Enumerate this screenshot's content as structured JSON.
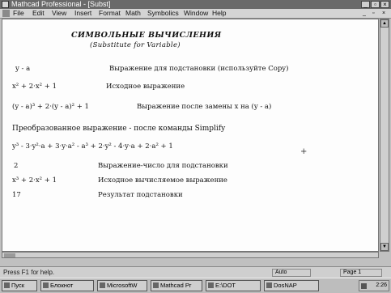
{
  "window": {
    "title": "Mathcad Professional - [Subst]",
    "controls": [
      "_",
      "▫",
      "×"
    ]
  },
  "menu": {
    "items": [
      "File",
      "Edit",
      "View",
      "Insert",
      "Format",
      "Math",
      "Symbolics",
      "Window",
      "Help"
    ],
    "doc_controls": [
      "_",
      "▫",
      "×"
    ]
  },
  "document": {
    "heading": "СИМВОЛЬНЫЕ ВЫЧИСЛЕНИЯ",
    "subheading": "(Substitute for Variable)",
    "rows": [
      {
        "math": "y - a",
        "text": "Выражение для подстановки  (используйте Copy)"
      },
      {
        "math": "x² + 2·x² + 1",
        "text": "Исходное выражение"
      },
      {
        "math": "(y - a)³ + 2·(y - a)² + 1",
        "text": "Выражение после замены  x  на  (y - a)"
      }
    ],
    "simplify_label": "Преобразованное выражение - после команды Simplify",
    "simplify_result": "y³ - 3·y²·a + 3·y·a² - a³ + 2·y² - 4·y·a + 2·a² + 1",
    "rows2": [
      {
        "math": "2",
        "text": "Выражение-число для подстановки"
      },
      {
        "math": "x³ + 2·x² + 1",
        "text": "Исходное вычисляемое выражение"
      },
      {
        "math": "17",
        "text": "Результат подстановки"
      }
    ]
  },
  "statusbar": {
    "help": "Press F1 for help.",
    "mode": "Auto",
    "page": "Page 1"
  },
  "taskbar": {
    "buttons": [
      "Пуск",
      "Блокнот",
      "MicrosoftW",
      "Mathcad Pr",
      "E:\\DOT",
      "DosNAP"
    ],
    "clock": "2:26"
  }
}
